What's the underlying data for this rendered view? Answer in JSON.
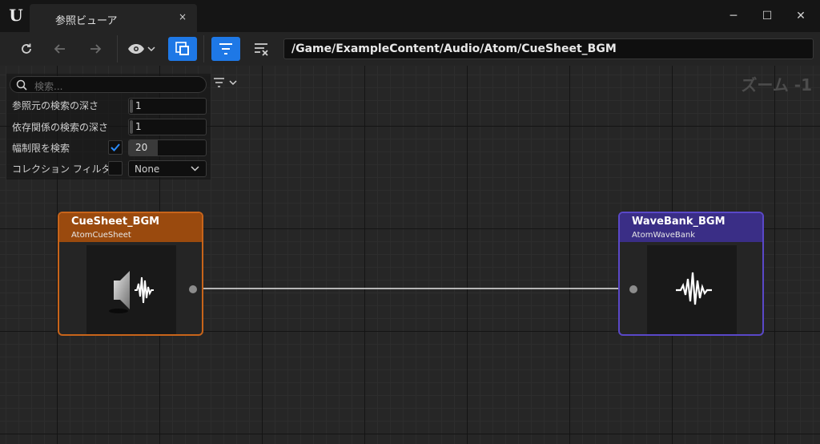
{
  "window": {
    "tab_title": "参照ビューア",
    "close_tab": "×",
    "minimize": "─",
    "maximize": "☐",
    "close": "✕"
  },
  "toolbar": {
    "path": "/Game/ExampleContent/Audio/Atom/CueSheet_BGM"
  },
  "graph": {
    "zoom_label": "ズーム -1"
  },
  "filters": {
    "search_placeholder": "検索...",
    "referencer_depth_label": "参照元の検索の深さ",
    "referencer_depth": "1",
    "dependency_depth_label": "依存関係の検索の深さ",
    "dependency_depth": "1",
    "breadth_limit_label": "幅制限を検索",
    "breadth_limit_checked": true,
    "breadth_limit": "20",
    "collection_filter_label": "コレクション フィルタ",
    "collection_filter_checked": false,
    "collection_filter_value": "None"
  },
  "nodes": [
    {
      "title": "CueSheet_BGM",
      "type": "AtomCueSheet",
      "header_color": "#9a4a0e",
      "border_color": "#c8641a",
      "icon": "speaker-waveform-icon"
    },
    {
      "title": "WaveBank_BGM",
      "type": "AtomWaveBank",
      "header_color": "#3a2e86",
      "border_color": "#5a48c8",
      "icon": "waveform-icon"
    }
  ],
  "colors": {
    "accent": "#1e78e6",
    "link": "#e6e6e6"
  }
}
